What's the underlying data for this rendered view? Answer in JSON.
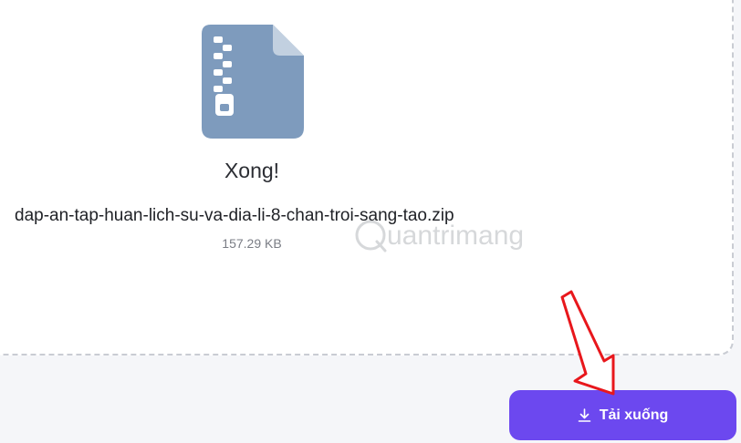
{
  "card": {
    "status_text": "Xong!",
    "file_name": "dap-an-tap-huan-lich-su-va-dia-li-8-chan-troi-sang-tao.zip",
    "file_size": "157.29 KB"
  },
  "file_icon": {
    "name": "zip-file-icon",
    "color": "#7e9bbd",
    "fold_color": "#c2d0e0"
  },
  "download_button": {
    "label": "Tải xuống",
    "icon": "download-icon",
    "color": "#6c48ef"
  },
  "annotation": {
    "icon": "red-arrow-icon",
    "color": "#e8171c"
  },
  "watermark": {
    "text": "uantrimang"
  }
}
